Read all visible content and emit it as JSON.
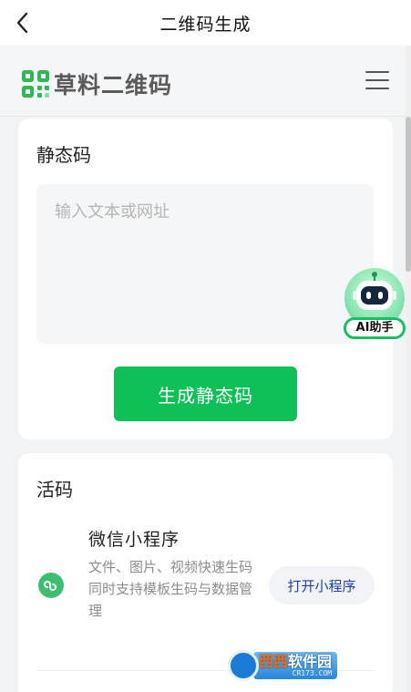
{
  "navbar": {
    "title": "二维码生成",
    "back_icon": "chevron-left-icon"
  },
  "brand": {
    "name": "草料二维码",
    "logo_color": "#2fb956",
    "menu_icon": "hamburger-menu-icon"
  },
  "static_card": {
    "title": "静态码",
    "input_value": "",
    "input_placeholder": "输入文本或网址",
    "generate_label": "生成静态码"
  },
  "ai_assistant": {
    "label": "AI助手",
    "icon": "robot-icon"
  },
  "active_card": {
    "title": "活码",
    "mini_program": {
      "name": "微信小程序",
      "desc_line1": "文件、图片、视频快速生码",
      "desc_line2": "同时支持模板生码与数据管理",
      "open_label": "打开小程序",
      "icon": "mini-program-icon"
    }
  },
  "watermark": {
    "main_a": "西西",
    "main_b": "软件园",
    "sub": "CR173.COM"
  },
  "colors": {
    "primary_green": "#0fc057",
    "link_blue": "#1c3fa8",
    "background": "#f2f3f5"
  }
}
